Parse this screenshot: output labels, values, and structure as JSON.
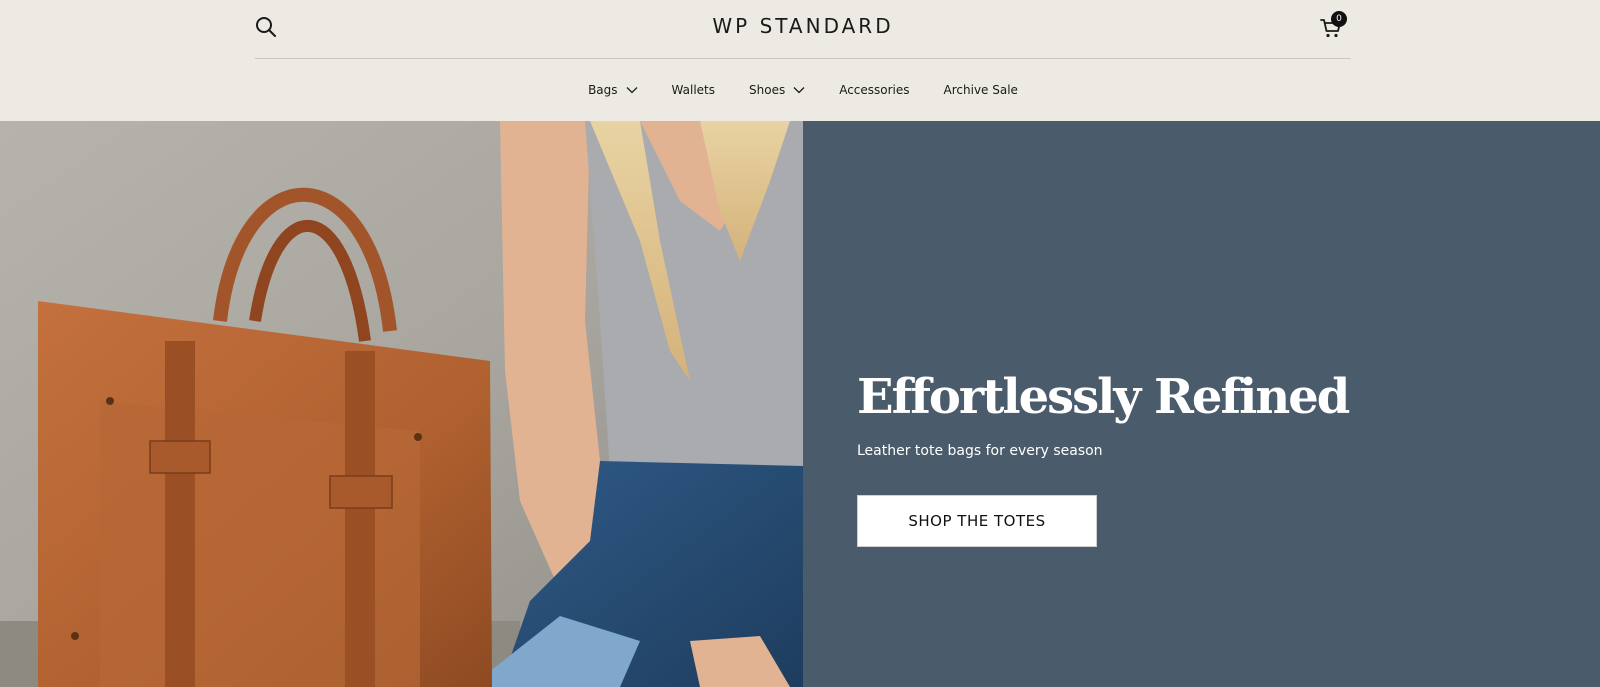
{
  "header": {
    "logo": "WP STANDARD",
    "search_icon": "search-icon",
    "cart_icon": "cart-icon",
    "cart_count": "0"
  },
  "nav": {
    "items": [
      {
        "label": "Bags",
        "has_dropdown": true
      },
      {
        "label": "Wallets",
        "has_dropdown": false
      },
      {
        "label": "Shoes",
        "has_dropdown": true
      },
      {
        "label": "Accessories",
        "has_dropdown": false
      },
      {
        "label": "Archive Sale",
        "has_dropdown": false
      }
    ]
  },
  "hero": {
    "headline": "Effortlessly Refined",
    "subheadline": "Leather tote bags for every season",
    "cta_label": "SHOP THE TOTES"
  },
  "colors": {
    "header_bg": "#eceae3",
    "hero_panel": "#4a5b6b",
    "leather": "#b8653a"
  }
}
